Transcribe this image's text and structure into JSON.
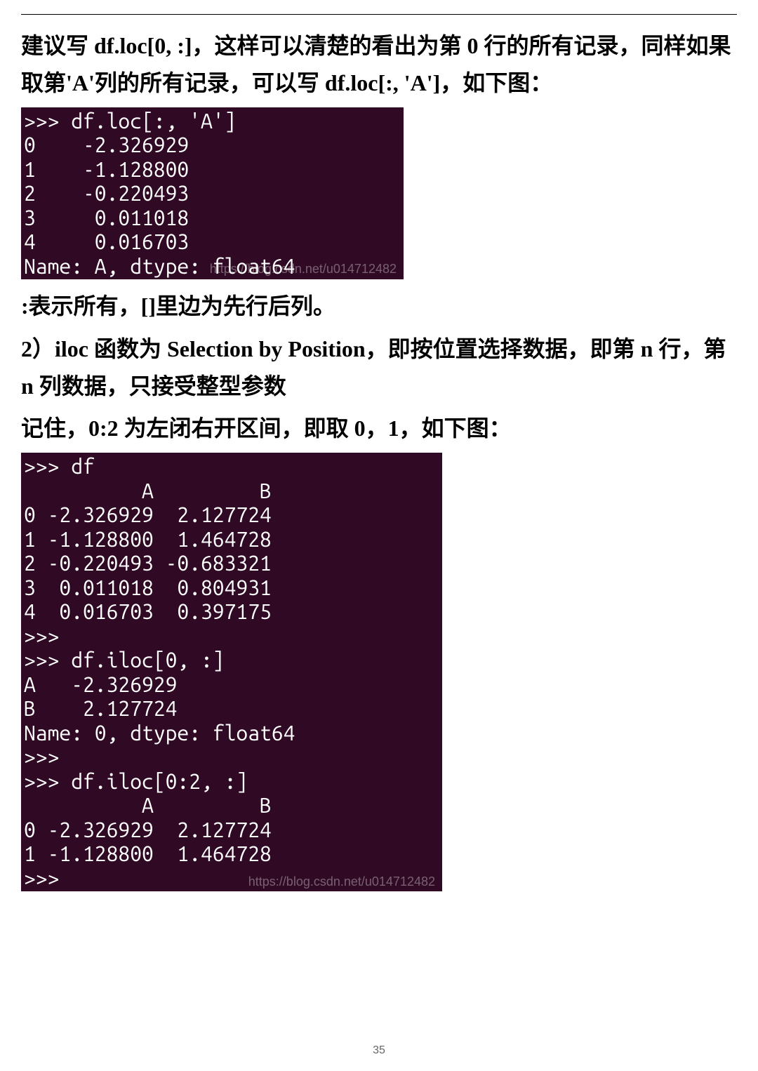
{
  "para1": "建议写 df.loc[0, :]，这样可以清楚的看出为第 0 行的所有记录，同样如果取第'A'列的所有记录，可以写 df.loc[:, 'A']，如下图：",
  "terminal1": {
    "lines": ">>> df.loc[:, 'A']\n0    -2.326929\n1    -1.128800\n2    -0.220493\n3     0.011018\n4     0.016703\nName: A, dtype: float64",
    "watermark": "https://blog.csdn.net/u014712482"
  },
  "para2": ":表示所有，[]里边为先行后列。",
  "para3": "2）iloc 函数为 Selection by Position，即按位置选择数据，即第 n 行，第 n 列数据，只接受整型参数",
  "para4": "记住，0:2 为左闭右开区间，即取 0，1，如下图：",
  "terminal2": {
    "lines": ">>> df\n          A         B\n0 -2.326929  2.127724\n1 -1.128800  1.464728\n2 -0.220493 -0.683321\n3  0.011018  0.804931\n4  0.016703  0.397175\n>>> \n>>> df.iloc[0, :]\nA   -2.326929\nB    2.127724\nName: 0, dtype: float64\n>>> \n>>> df.iloc[0:2, :]\n          A         B\n0 -2.326929  2.127724\n1 -1.128800  1.464728\n>>> ",
    "watermark": "https://blog.csdn.net/u014712482"
  },
  "page_number": "35"
}
